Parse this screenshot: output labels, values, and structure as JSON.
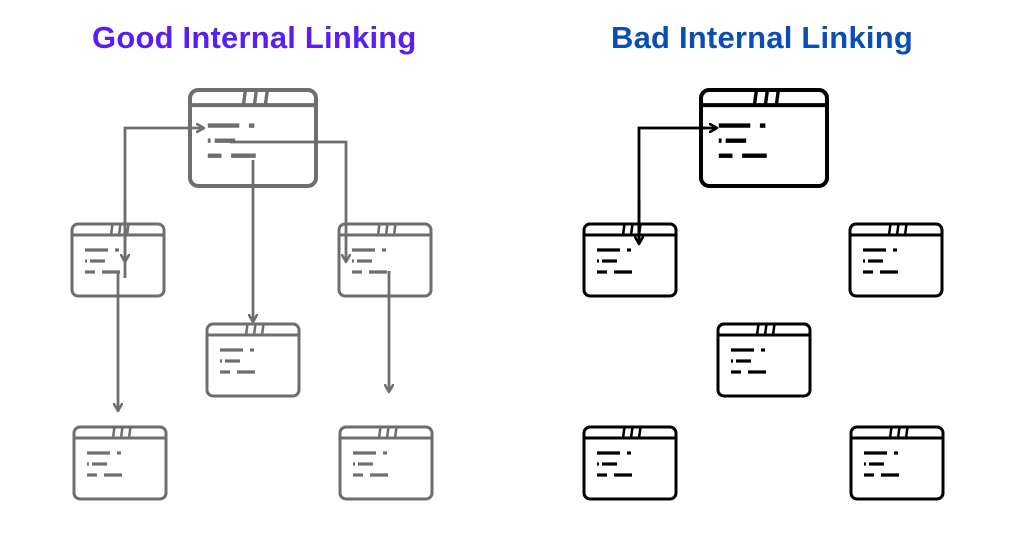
{
  "colors": {
    "good_title": "#5a1ff0",
    "bad_title": "#0b4db3",
    "good_stroke": "#6e6e6e",
    "bad_stroke": "#000000"
  },
  "good": {
    "title": "Good Internal Linking",
    "pages": [
      "home",
      "left-child",
      "center-child",
      "right-child",
      "bottom-left",
      "bottom-right"
    ],
    "links": [
      {
        "from": "home",
        "to": "left-child"
      },
      {
        "from": "home",
        "to": "center-child"
      },
      {
        "from": "home",
        "to": "right-child"
      },
      {
        "from": "left-child",
        "to": "bottom-left"
      },
      {
        "from": "right-child",
        "to": "bottom-right"
      },
      {
        "from": "left-child",
        "to": "home"
      }
    ]
  },
  "bad": {
    "title": "Bad Internal Linking",
    "pages": [
      "home",
      "left-child",
      "center-child",
      "right-child",
      "bottom-left",
      "bottom-right"
    ],
    "links": [
      {
        "from": "left-child",
        "to": "home"
      },
      {
        "from": "home",
        "to": "left-child"
      }
    ]
  }
}
